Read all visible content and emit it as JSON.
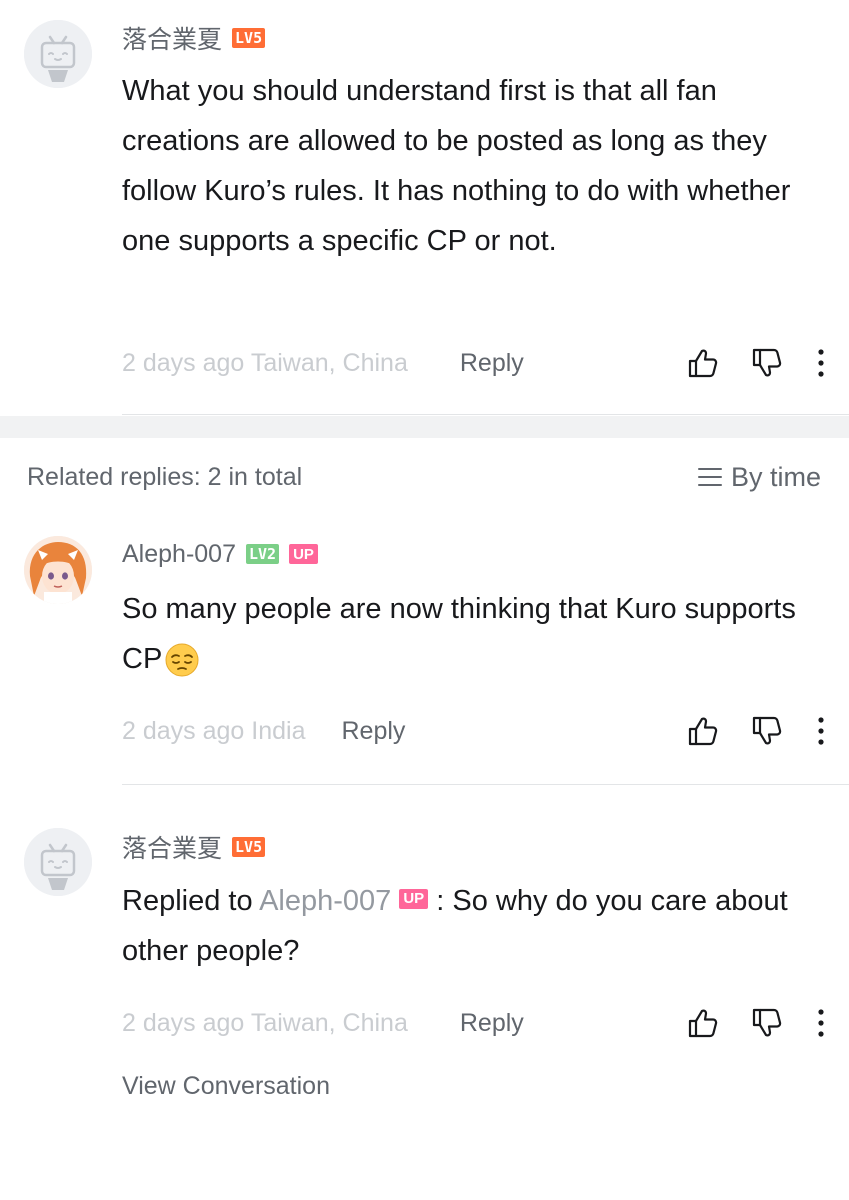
{
  "main_comment": {
    "username": "落合業夏",
    "level": "LV5",
    "text": "What you should understand first is that all fan creations are allowed to be posted as long as they follow Kuro’s rules. It has nothing to do with whether one supports a specific CP or not.",
    "time": "2 days ago",
    "location": "Taiwan, China",
    "reply_label": "Reply"
  },
  "related": {
    "label": "Related replies: 2 in total",
    "sort_label": "By time"
  },
  "replies": [
    {
      "username": "Aleph-007",
      "level": "LV2",
      "badge": "UP",
      "text": "So many people are now thinking that Kuro supports CP",
      "emoji": "pensive-face-emoji",
      "time": "2 days ago",
      "location": "India",
      "reply_label": "Reply"
    },
    {
      "username": "落合業夏",
      "level": "LV5",
      "prefix": "Replied to",
      "mention": "Aleph-007",
      "mention_badge": "UP",
      "text": ": So why do you care about other people?",
      "time": "2 days ago",
      "location": "Taiwan, China",
      "reply_label": "Reply"
    }
  ],
  "view_conversation": "View Conversation",
  "icons": {
    "like": "thumbs-up-icon",
    "dislike": "thumbs-down-icon",
    "more": "more-vertical-icon",
    "sort": "list-sort-icon"
  },
  "colors": {
    "lv5": "#ff6d35",
    "lv2": "#7bcf87",
    "up_badge": "#ff6699",
    "muted_text": "#c9ccd0",
    "secondary_text": "#61666d"
  }
}
